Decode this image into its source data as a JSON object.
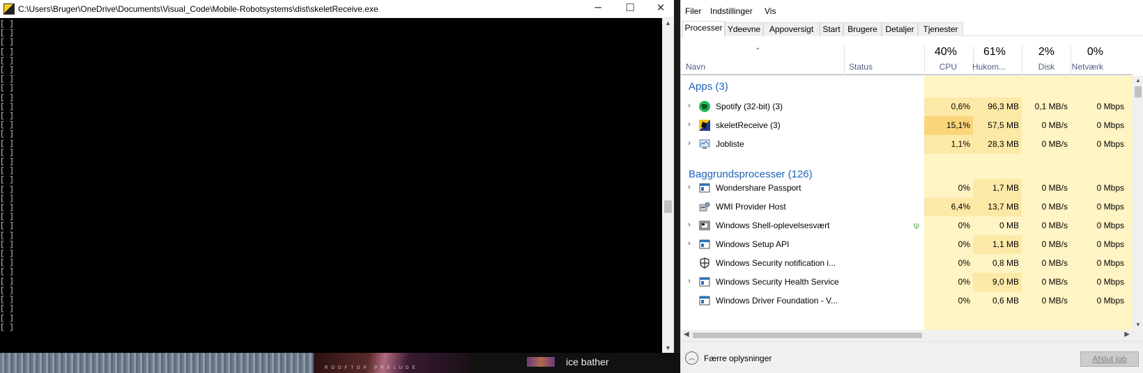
{
  "console": {
    "title": "C:\\Users\\Bruger\\OneDrive\\Documents\\Visual_Code\\Mobile-Robotsystems\\dist\\skeletReceive.exe",
    "controls": {
      "minimize": "─",
      "maximize": "☐",
      "close": "✕"
    },
    "bracket_line": "[ ]",
    "bracket_count": 34
  },
  "taskbar": {
    "album_text": "ROOFTOP PRELUDE",
    "song_title": "ice bather"
  },
  "taskmgr": {
    "menu": [
      "Filer",
      "Indstillinger",
      "Vis"
    ],
    "tabs": [
      "Processer",
      "Ydeevne",
      "Appoversigt",
      "Start",
      "Brugere",
      "Detaljer",
      "Tjenester"
    ],
    "active_tab": "Processer",
    "columns": {
      "name": "Navn",
      "status": "Status",
      "cpu": {
        "percent": "40%",
        "label": "CPU"
      },
      "memory": {
        "percent": "61%",
        "label": "Hukom..."
      },
      "disk": {
        "percent": "2%",
        "label": "Disk"
      },
      "network": {
        "percent": "0%",
        "label": "Netværk"
      }
    },
    "groups": {
      "apps_title": "Apps (3)",
      "background_title": "Baggrundsprocesser (126)"
    },
    "apps": [
      {
        "name": "Spotify (32-bit) (3)",
        "icon": "spotify-icon",
        "expandable": true,
        "cpu": "0,6%",
        "memory": "96,3 MB",
        "disk": "0,1 MB/s",
        "network": "0 Mbps"
      },
      {
        "name": "skeletReceive (3)",
        "icon": "skeletreceive-icon",
        "expandable": true,
        "cpu": "15,1%",
        "memory": "57,5 MB",
        "disk": "0 MB/s",
        "network": "0 Mbps"
      },
      {
        "name": "Jobliste",
        "icon": "task-manager-icon",
        "expandable": true,
        "cpu": "1,1%",
        "memory": "28,3 MB",
        "disk": "0 MB/s",
        "network": "0 Mbps"
      }
    ],
    "background": [
      {
        "name": "Wondershare Passport",
        "icon": "window-icon",
        "expandable": true,
        "cpu": "0%",
        "memory": "1,7 MB",
        "disk": "0 MB/s",
        "network": "0 Mbps"
      },
      {
        "name": "WMI Provider Host",
        "icon": "wmi-icon",
        "expandable": false,
        "cpu": "6,4%",
        "memory": "13,7 MB",
        "disk": "0 MB/s",
        "network": "0 Mbps"
      },
      {
        "name": "Windows Shell-oplevelsesvært",
        "icon": "shell-icon",
        "expandable": true,
        "eco": true,
        "cpu": "0%",
        "memory": "0 MB",
        "disk": "0 MB/s",
        "network": "0 Mbps"
      },
      {
        "name": "Windows Setup API",
        "icon": "window-icon",
        "expandable": true,
        "cpu": "0%",
        "memory": "1,1 MB",
        "disk": "0 MB/s",
        "network": "0 Mbps"
      },
      {
        "name": "Windows Security notification i...",
        "icon": "shield-icon",
        "expandable": false,
        "cpu": "0%",
        "memory": "0,8 MB",
        "disk": "0 MB/s",
        "network": "0 Mbps"
      },
      {
        "name": "Windows Security Health Service",
        "icon": "window-icon",
        "expandable": true,
        "cpu": "0%",
        "memory": "9,0 MB",
        "disk": "0 MB/s",
        "network": "0 Mbps"
      },
      {
        "name": "Windows Driver Foundation - V...",
        "icon": "window-icon",
        "expandable": false,
        "cpu": "0%",
        "memory": "0,6 MB",
        "disk": "0 MB/s",
        "network": "0 Mbps"
      }
    ],
    "footer": {
      "fewer_details": "Færre oplysninger",
      "end_task": "Afslut job"
    },
    "colors": {
      "accent": "#1e63b8",
      "heat_light": "#fff4c4",
      "heat_mid": "#fde9a7",
      "heat_high": "#fad57a"
    }
  }
}
